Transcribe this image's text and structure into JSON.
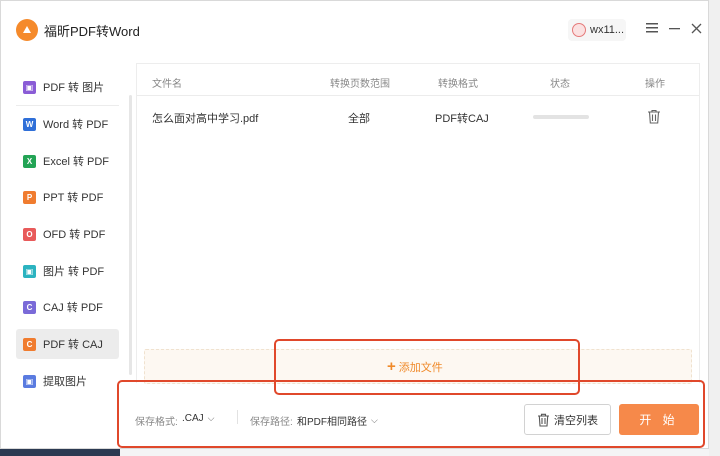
{
  "app": {
    "title": "福昕PDF转Word",
    "user": "wx11...",
    "menu_icon": "hamburger-menu-icon",
    "minimize_icon": "minimize-icon",
    "close_icon": "close-icon"
  },
  "sidebar": {
    "items": [
      {
        "label": "PDF 转 图片",
        "icon": "pdf-to-image-icon",
        "color": "#8a5cd6",
        "glyph": "▣"
      },
      {
        "label": "Word 转 PDF",
        "icon": "word-to-pdf-icon",
        "color": "#2f6fd8",
        "glyph": "W"
      },
      {
        "label": "Excel 转 PDF",
        "icon": "excel-to-pdf-icon",
        "color": "#23a455",
        "glyph": "X"
      },
      {
        "label": "PPT 转 PDF",
        "icon": "ppt-to-pdf-icon",
        "color": "#f07c2f",
        "glyph": "P"
      },
      {
        "label": "OFD 转 PDF",
        "icon": "ofd-to-pdf-icon",
        "color": "#e85a5a",
        "glyph": "O"
      },
      {
        "label": "图片 转 PDF",
        "icon": "image-to-pdf-icon",
        "color": "#2bb3c0",
        "glyph": "▣"
      },
      {
        "label": "CAJ 转 PDF",
        "icon": "caj-to-pdf-icon",
        "color": "#7a6ad8",
        "glyph": "C"
      },
      {
        "label": "PDF 转 CAJ",
        "icon": "pdf-to-caj-icon",
        "color": "#f07c2f",
        "glyph": "C",
        "active": true
      },
      {
        "label": "提取图片",
        "icon": "extract-image-icon",
        "color": "#5a7be0",
        "glyph": "▣"
      }
    ]
  },
  "table": {
    "headers": {
      "filename": "文件名",
      "range": "转换页数范围",
      "format": "转换格式",
      "status": "状态",
      "action": "操作"
    },
    "rows": [
      {
        "filename": "怎么面对高中学习.pdf",
        "range": "全部",
        "format": "PDF转CAJ",
        "status_progress": 0,
        "action_icon": "trash-icon"
      }
    ]
  },
  "add_files": {
    "label": "添加文件"
  },
  "bottom": {
    "save_format_label": "保存格式:",
    "save_format_value": ".CAJ",
    "save_path_label": "保存路径:",
    "save_path_value": "和PDF相同路径",
    "clear_label": "清空列表",
    "start_label": "开 始"
  },
  "colors": {
    "accent": "#f6894a",
    "annotation": "#e0482b"
  }
}
